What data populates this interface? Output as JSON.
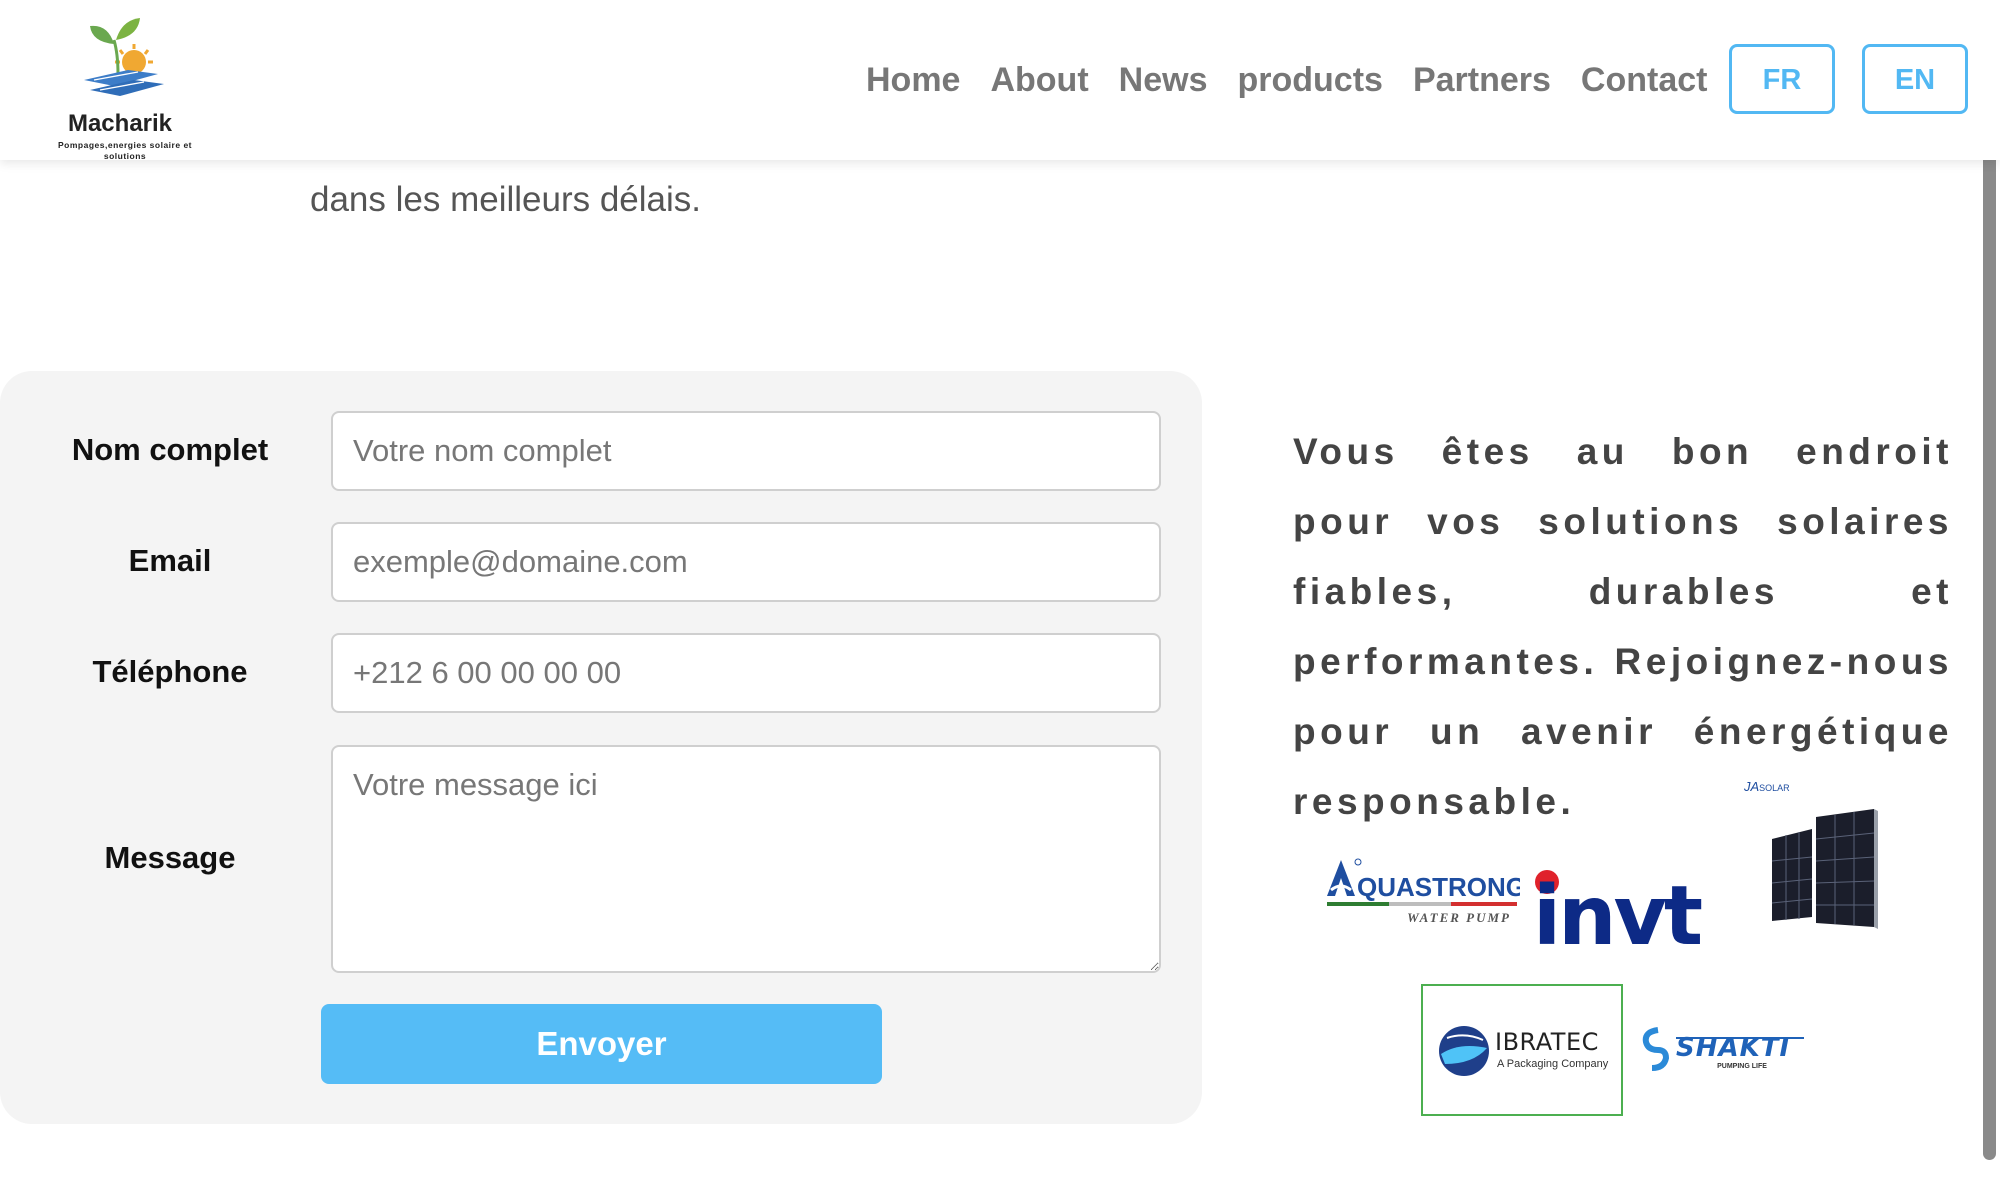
{
  "header": {
    "logo": {
      "name": "Macharik",
      "tagline": "Pompages,energies solaire et solutions"
    },
    "nav": [
      {
        "label": "Home"
      },
      {
        "label": "About"
      },
      {
        "label": "News"
      },
      {
        "label": "products"
      },
      {
        "label": "Partners"
      },
      {
        "label": "Contact"
      }
    ],
    "languages": [
      {
        "label": "FR"
      },
      {
        "label": "EN"
      }
    ]
  },
  "intro": {
    "tail_text": "dans les meilleurs délais."
  },
  "form": {
    "name": {
      "label": "Nom complet",
      "placeholder": "Votre nom complet"
    },
    "email": {
      "label": "Email",
      "placeholder": "exemple@domaine.com"
    },
    "phone": {
      "label": "Téléphone",
      "placeholder": "+212 6 00 00 00 00"
    },
    "message": {
      "label": "Message",
      "placeholder": "Votre message ici"
    },
    "submit_label": "Envoyer"
  },
  "promo": {
    "text": "Vous êtes au bon endroit pour vos solutions solaires fiables, durables et performantes. Rejoignez-nous pour un avenir énergétique responsable."
  },
  "partners": {
    "logos": [
      {
        "name": "aquastrong-logo",
        "text": "QUASTRONG",
        "initial": "A",
        "sub": "WATER PUMP"
      },
      {
        "name": "invt-logo",
        "text": "invt"
      },
      {
        "name": "ja-solar-logo",
        "text": "JA",
        "sub": "SOLAR"
      },
      {
        "name": "ibratec-logo",
        "text": "IBRATEC",
        "sub": "A Packaging Company"
      },
      {
        "name": "shakti-logo",
        "text": "SHAKTI",
        "sub": "PUMPING LIFE"
      }
    ]
  },
  "colors": {
    "accent": "#52b8f3",
    "submit": "#55bcf6",
    "nav_text": "#777777",
    "panel_bg": "#f4f4f4",
    "invt_blue": "#0d2a86",
    "invt_red": "#e0222b"
  }
}
